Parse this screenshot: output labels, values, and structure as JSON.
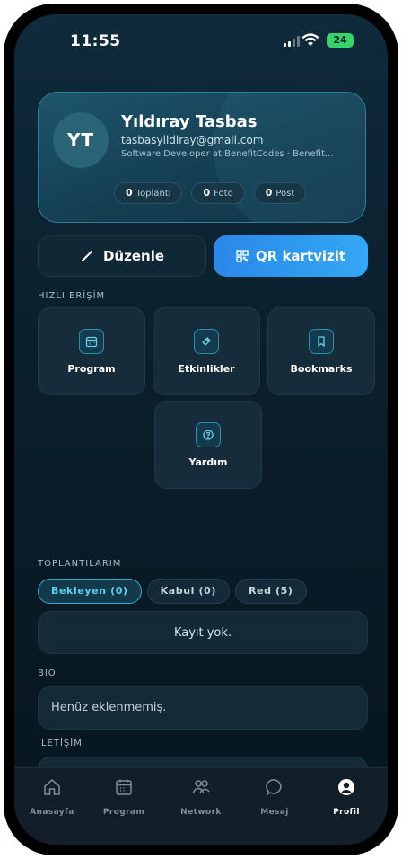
{
  "status_bar": {
    "time": "11:55",
    "battery": "24"
  },
  "profile": {
    "initials": "YT",
    "name": "Yıldıray Tasbas",
    "email": "tasbasyildiray@gmail.com",
    "title": "Software Developer at BenefitCodes · Benefit...",
    "stats": [
      {
        "value": "0",
        "label": "Toplantı"
      },
      {
        "value": "0",
        "label": "Foto"
      },
      {
        "value": "0",
        "label": "Post"
      }
    ]
  },
  "actions": {
    "edit_label": "Düzenle",
    "qr_label": "QR kartvizit"
  },
  "quick_access": {
    "label": "HIZLI ERİŞİM",
    "items": [
      {
        "label": "Program",
        "icon": "calendar-icon"
      },
      {
        "label": "Etkinlikler",
        "icon": "ticket-icon"
      },
      {
        "label": "Bookmarks",
        "icon": "bookmark-icon"
      },
      {
        "label": "Yardım",
        "icon": "help-icon"
      }
    ]
  },
  "meetings": {
    "label": "TOPLANTILARIM",
    "tabs": [
      "Bekleyen (0)",
      "Kabul (0)",
      "Red (5)"
    ],
    "empty_text": "Kayıt yok."
  },
  "bio": {
    "label": "BIO",
    "text": "Henüz eklenmemiş."
  },
  "contact": {
    "label": "İLETİŞİM"
  },
  "nav": {
    "items": [
      {
        "label": "Anasayfa",
        "icon": "home-icon"
      },
      {
        "label": "Program",
        "icon": "calendar-icon"
      },
      {
        "label": "Network",
        "icon": "people-icon"
      },
      {
        "label": "Mesaj",
        "icon": "chat-icon"
      },
      {
        "label": "Profil",
        "icon": "profile-icon"
      }
    ],
    "active": "Profil"
  },
  "colors": {
    "accent": "#33a8f5",
    "teal": "#3aa9c9",
    "background": "#0a1d2a"
  }
}
